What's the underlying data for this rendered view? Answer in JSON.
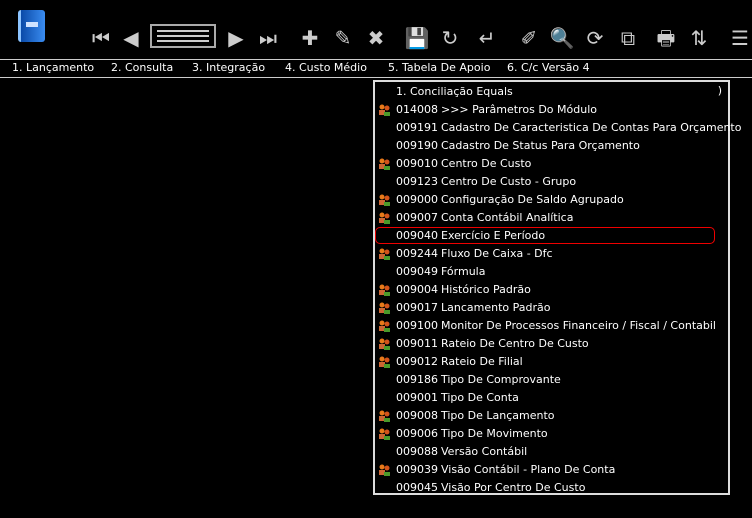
{
  "toolbar": {
    "icons": [
      "first-icon",
      "previous-icon",
      "list-icon",
      "next-icon",
      "last-icon",
      "add-icon",
      "edit-icon",
      "delete-icon",
      "save-icon",
      "copy-icon",
      "confirm-icon",
      "clean-icon",
      "search-icon",
      "refresh-icon",
      "preview-icon",
      "print-icon",
      "sort-icon",
      "add-list-icon"
    ],
    "glyphs": [
      "⏮",
      "◀",
      "",
      "▶",
      "⏭",
      "✚",
      "✎",
      "✖",
      "💾",
      "↻",
      "↵",
      "✐",
      "🔍",
      "⟳",
      "⧉",
      "🖶",
      "⇅",
      "☰"
    ]
  },
  "menu": [
    "1. Lançamento",
    "2. Consulta",
    "3. Integração",
    "4. Custo Médio",
    "5. Tabela De Apoio",
    "6. C/c Versão 4"
  ],
  "popup": {
    "title": "1. Conciliação Equals",
    "scroll_mark": ")",
    "highlighted": "009040",
    "highlight_color": "#e00000",
    "items": [
      {
        "code": "014008",
        "label": ">>> Parâmetros Do Módulo",
        "icon": true
      },
      {
        "code": "009191",
        "label": "Cadastro De Caracteristica De Contas Para Orçamento",
        "icon": false
      },
      {
        "code": "009190",
        "label": "Cadastro De Status Para Orçamento",
        "icon": false
      },
      {
        "code": "009010",
        "label": "Centro De Custo",
        "icon": true
      },
      {
        "code": "009123",
        "label": "Centro De Custo - Grupo",
        "icon": false
      },
      {
        "code": "009000",
        "label": "Configuração De Saldo Agrupado",
        "icon": true
      },
      {
        "code": "009007",
        "label": "Conta Contábil Analítica",
        "icon": true
      },
      {
        "code": "009040",
        "label": "Exercício E Período",
        "icon": false
      },
      {
        "code": "009244",
        "label": "Fluxo De Caixa - Dfc",
        "icon": true
      },
      {
        "code": "009049",
        "label": "Fórmula",
        "icon": false
      },
      {
        "code": "009004",
        "label": "Histórico Padrão",
        "icon": true
      },
      {
        "code": "009017",
        "label": "Lancamento Padrão",
        "icon": true
      },
      {
        "code": "009100",
        "label": "Monitor De Processos Financeiro / Fiscal / Contabil",
        "icon": true
      },
      {
        "code": "009011",
        "label": "Rateio De Centro De Custo",
        "icon": true
      },
      {
        "code": "009012",
        "label": "Rateio De Filial",
        "icon": true
      },
      {
        "code": "009186",
        "label": "Tipo De Comprovante",
        "icon": false
      },
      {
        "code": "009001",
        "label": "Tipo De Conta",
        "icon": false
      },
      {
        "code": "009008",
        "label": "Tipo De Lançamento",
        "icon": true
      },
      {
        "code": "009006",
        "label": "Tipo De Movimento",
        "icon": true
      },
      {
        "code": "009088",
        "label": "Versão Contábil",
        "icon": false
      },
      {
        "code": "009039",
        "label": "Visão Contábil - Plano De Conta",
        "icon": true
      },
      {
        "code": "009045",
        "label": "Visão Por Centro De Custo",
        "icon": false
      }
    ]
  }
}
